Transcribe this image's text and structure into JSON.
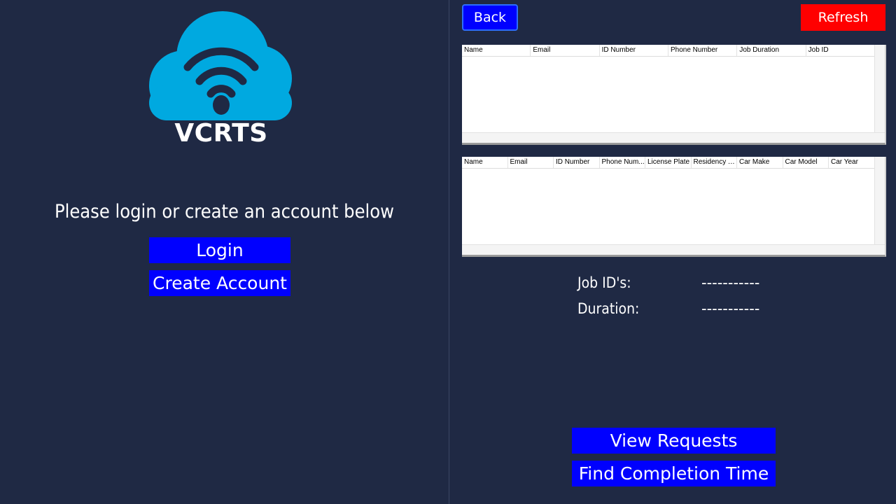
{
  "login_panel": {
    "brand": "VCRTS",
    "prompt": "Please login or create an account below",
    "login_label": "Login",
    "create_account_label": "Create Account",
    "logo_color": "#00a9e0",
    "logo_icon": "cloud-wifi-icon"
  },
  "admin_panel": {
    "back_label": "Back",
    "refresh_label": "Refresh",
    "jobs_table": {
      "columns": [
        "Name",
        "Email",
        "ID Number",
        "Phone Number",
        "Job Duration",
        "Job ID"
      ]
    },
    "cars_table": {
      "columns": [
        "Name",
        "Email",
        "ID Number",
        "Phone Num...",
        "License Plate",
        "Residency Ti...",
        "Car Make",
        "Car Model",
        "Car Year"
      ]
    },
    "job_ids_label": "Job ID's:",
    "job_ids_value": "-----------",
    "duration_label": "Duration:",
    "duration_value": "-----------",
    "view_requests_label": "View Requests",
    "find_completion_label": "Find Completion Time"
  },
  "colors": {
    "background": "#1f2944",
    "primary_button": "#0000ff",
    "refresh_button": "#ff0000"
  }
}
